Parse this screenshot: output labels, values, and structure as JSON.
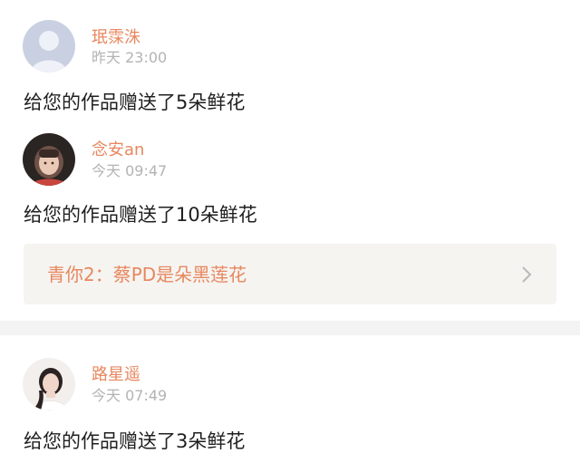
{
  "feed": {
    "items": [
      {
        "user_name": "珉霂洙",
        "time": "昨天 23:00",
        "gift_text": "给您的作品赠送了5朵鲜花",
        "avatar": "default-avatar-icon"
      },
      {
        "user_name": "念安an",
        "time": "今天 09:47",
        "gift_text": "给您的作品赠送了10朵鲜花",
        "avatar": "user-photo-avatar"
      },
      {
        "user_name": "路星遥",
        "time": "今天 07:49",
        "gift_text": "给您的作品赠送了3朵鲜花",
        "avatar": "user-photo-avatar"
      }
    ],
    "quoted_post": {
      "text": "青你2：蔡PD是朵黑莲花",
      "arrow_icon": "chevron-right-icon"
    }
  },
  "colors": {
    "accent": "#e8875e",
    "time": "#b3b3b3",
    "text": "#1f1f1f",
    "quote_bg": "#f5f4f1",
    "divider": "#f3f3f3"
  }
}
